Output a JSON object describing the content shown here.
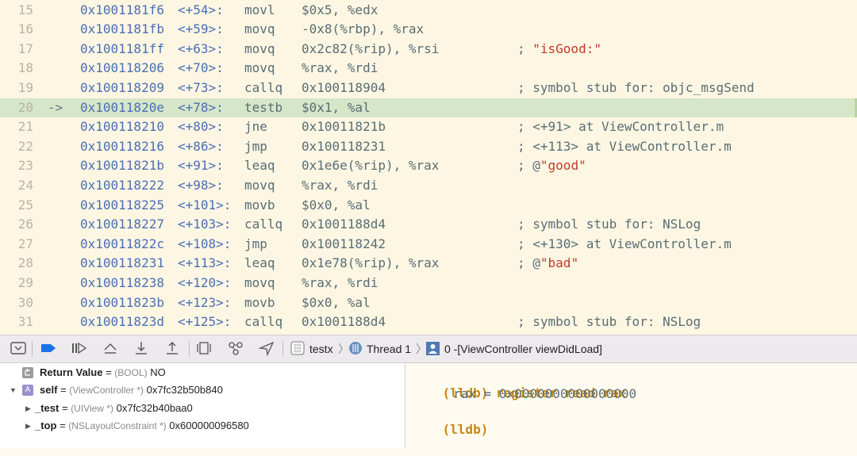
{
  "disassembly": [
    {
      "line": "15",
      "arrow": "",
      "addr": "0x1001181f6",
      "off": "<+54>:",
      "mnemonic": "movl",
      "operands": "$0x5, %edx",
      "comment": "",
      "comment_str": "",
      "current": false
    },
    {
      "line": "16",
      "arrow": "",
      "addr": "0x1001181fb",
      "off": "<+59>:",
      "mnemonic": "movq",
      "operands": "-0x8(%rbp), %rax",
      "comment": "",
      "comment_str": "",
      "current": false
    },
    {
      "line": "17",
      "arrow": "",
      "addr": "0x1001181ff",
      "off": "<+63>:",
      "mnemonic": "movq",
      "operands": "0x2c82(%rip), %rsi",
      "comment": "; ",
      "comment_str": "\"isGood:\"",
      "current": false
    },
    {
      "line": "18",
      "arrow": "",
      "addr": "0x100118206",
      "off": "<+70>:",
      "mnemonic": "movq",
      "operands": "%rax, %rdi",
      "comment": "",
      "comment_str": "",
      "current": false
    },
    {
      "line": "19",
      "arrow": "",
      "addr": "0x100118209",
      "off": "<+73>:",
      "mnemonic": "callq",
      "operands": "0x100118904",
      "comment": "; symbol stub for: objc_msgSend",
      "comment_str": "",
      "current": false
    },
    {
      "line": "20",
      "arrow": "->",
      "addr": "0x10011820e",
      "off": "<+78>:",
      "mnemonic": "testb",
      "operands": "$0x1, %al",
      "comment": "",
      "comment_str": "",
      "current": true
    },
    {
      "line": "21",
      "arrow": "",
      "addr": "0x100118210",
      "off": "<+80>:",
      "mnemonic": "jne",
      "operands": "0x10011821b",
      "comment": "; <+91> at ViewController.m",
      "comment_str": "",
      "current": false
    },
    {
      "line": "22",
      "arrow": "",
      "addr": "0x100118216",
      "off": "<+86>:",
      "mnemonic": "jmp",
      "operands": "0x100118231",
      "comment": "; <+113> at ViewController.m",
      "comment_str": "",
      "current": false
    },
    {
      "line": "23",
      "arrow": "",
      "addr": "0x10011821b",
      "off": "<+91>:",
      "mnemonic": "leaq",
      "operands": "0x1e6e(%rip), %rax",
      "comment": "; @",
      "comment_str": "\"good\"",
      "current": false
    },
    {
      "line": "24",
      "arrow": "",
      "addr": "0x100118222",
      "off": "<+98>:",
      "mnemonic": "movq",
      "operands": "%rax, %rdi",
      "comment": "",
      "comment_str": "",
      "current": false
    },
    {
      "line": "25",
      "arrow": "",
      "addr": "0x100118225",
      "off": "<+101>:",
      "mnemonic": "movb",
      "operands": "$0x0, %al",
      "comment": "",
      "comment_str": "",
      "current": false
    },
    {
      "line": "26",
      "arrow": "",
      "addr": "0x100118227",
      "off": "<+103>:",
      "mnemonic": "callq",
      "operands": "0x1001188d4",
      "comment": "; symbol stub for: NSLog",
      "comment_str": "",
      "current": false
    },
    {
      "line": "27",
      "arrow": "",
      "addr": "0x10011822c",
      "off": "<+108>:",
      "mnemonic": "jmp",
      "operands": "0x100118242",
      "comment": "; <+130> at ViewController.m",
      "comment_str": "",
      "current": false
    },
    {
      "line": "28",
      "arrow": "",
      "addr": "0x100118231",
      "off": "<+113>:",
      "mnemonic": "leaq",
      "operands": "0x1e78(%rip), %rax",
      "comment": "; @",
      "comment_str": "\"bad\"",
      "current": false
    },
    {
      "line": "29",
      "arrow": "",
      "addr": "0x100118238",
      "off": "<+120>:",
      "mnemonic": "movq",
      "operands": "%rax, %rdi",
      "comment": "",
      "comment_str": "",
      "current": false
    },
    {
      "line": "30",
      "arrow": "",
      "addr": "0x10011823b",
      "off": "<+123>:",
      "mnemonic": "movb",
      "operands": "$0x0, %al",
      "comment": "",
      "comment_str": "",
      "current": false
    },
    {
      "line": "31",
      "arrow": "",
      "addr": "0x10011823d",
      "off": "<+125>:",
      "mnemonic": "callq",
      "operands": "0x1001188d4",
      "comment": "; symbol stub for: NSLog",
      "comment_str": "",
      "current": false
    }
  ],
  "toolbar": {
    "icons": [
      "hide-debug-area-icon",
      "breakpoints-toggle-icon",
      "continue-icon",
      "step-over-icon",
      "step-into-icon",
      "step-out-icon",
      "view-hierarchy-icon",
      "memory-graph-icon",
      "simulate-location-icon"
    ],
    "breadcrumb": {
      "target": "testx",
      "thread": "Thread 1",
      "frame": "0 -[ViewController viewDidLoad]"
    },
    "colors": {
      "accent": "#1a73e8"
    }
  },
  "variables": [
    {
      "name": "Return Value",
      "eq": " = ",
      "type": "(BOOL)",
      "value": "NO",
      "icon": "return-value-icon",
      "icon_letter": "",
      "disclosure": "",
      "indent": 0
    },
    {
      "name": "self",
      "eq": " = ",
      "type": "(ViewController *)",
      "value": "0x7fc32b50b840",
      "icon": "object-icon",
      "icon_letter": "A",
      "disclosure": "▼",
      "indent": 0
    },
    {
      "name": "_test",
      "eq": " = ",
      "type": "(UIView *)",
      "value": "0x7fc32b40baa0",
      "icon": "",
      "icon_letter": "",
      "disclosure": "▶",
      "indent": 1
    },
    {
      "name": "_top",
      "eq": " = ",
      "type": "(NSLayoutConstraint *)",
      "value": "0x600000096580",
      "icon": "",
      "icon_letter": "",
      "disclosure": "▶",
      "indent": 1
    }
  ],
  "console": {
    "prompt": "(lldb)",
    "command": "register read rax",
    "output": "rax = 0x0000000000000000",
    "prompt2": "(lldb)"
  }
}
